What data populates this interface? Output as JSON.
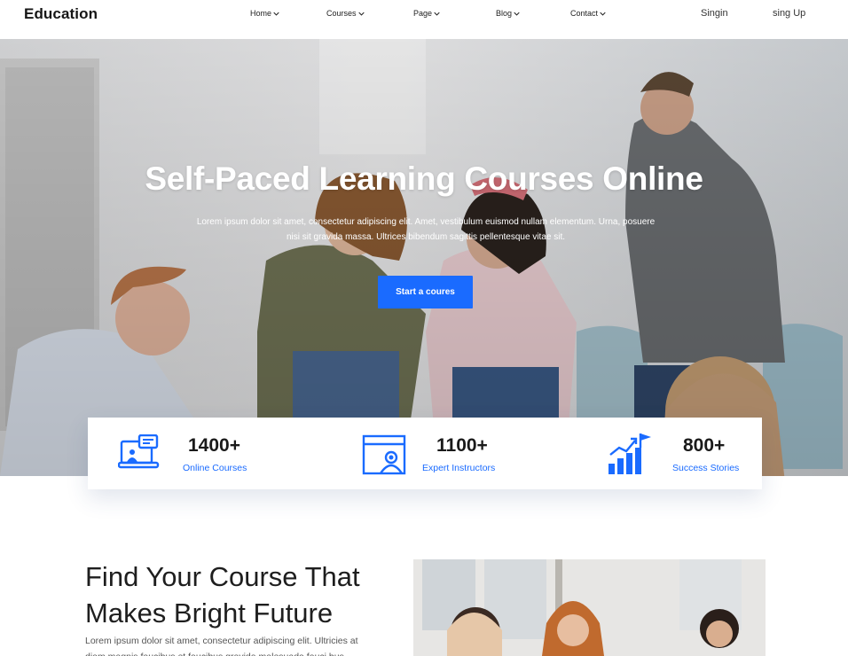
{
  "brand": {
    "logo": "Education"
  },
  "nav": {
    "items": [
      {
        "label": "Home"
      },
      {
        "label": "Courses"
      },
      {
        "label": "Page"
      },
      {
        "label": "Blog"
      },
      {
        "label": "Contact"
      }
    ],
    "signin": "Singin",
    "signup": "sing Up"
  },
  "hero": {
    "title": "Self-Paced Learning Courses Online",
    "subtitle_line1": "Lorem ipsum dolor sit amet, consectetur adipiscing elit. Amet, vestibulum euismod nullam elementum. Urna, posuere",
    "subtitle_line2": "nisi sit gravida massa. Ultrices bibendum sagittis pellentesque vitae sit.",
    "cta": "Start a coures"
  },
  "stats": [
    {
      "number": "1400+",
      "label": "Online Courses",
      "icon": "online-course-icon"
    },
    {
      "number": "1100+",
      "label": "Expert Instructors",
      "icon": "instructor-icon"
    },
    {
      "number": "800+",
      "label": "Success Stories",
      "icon": "growth-chart-icon"
    }
  ],
  "section": {
    "title_line1": "Find Your Course That",
    "title_line2": "Makes Bright Future",
    "body_line1": "Lorem ipsum dolor sit amet, consectetur adipiscing elit. Ultricies at",
    "body_line2": "diam magnis faucibus et faucibus gravida malesuada fauci bus"
  },
  "colors": {
    "accent": "#1a6bff",
    "text": "#1b1b1b"
  }
}
